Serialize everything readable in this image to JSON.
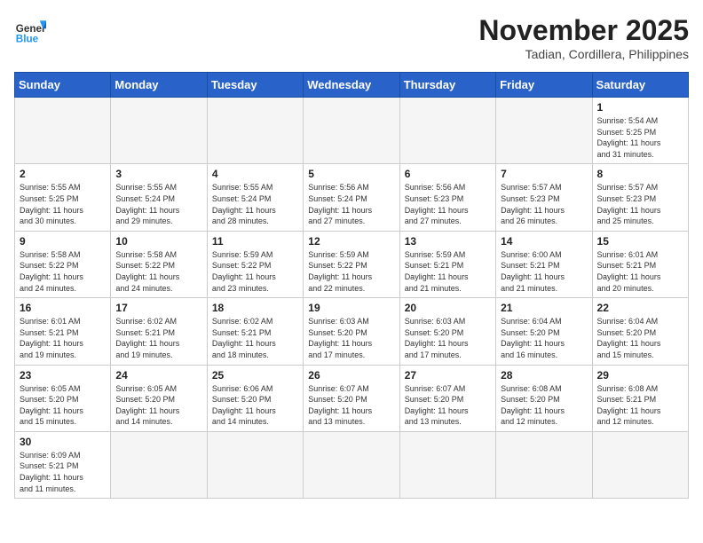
{
  "header": {
    "logo_general": "General",
    "logo_blue": "Blue",
    "month_year": "November 2025",
    "location": "Tadian, Cordillera, Philippines"
  },
  "weekdays": [
    "Sunday",
    "Monday",
    "Tuesday",
    "Wednesday",
    "Thursday",
    "Friday",
    "Saturday"
  ],
  "weeks": [
    [
      {
        "day": "",
        "info": ""
      },
      {
        "day": "",
        "info": ""
      },
      {
        "day": "",
        "info": ""
      },
      {
        "day": "",
        "info": ""
      },
      {
        "day": "",
        "info": ""
      },
      {
        "day": "",
        "info": ""
      },
      {
        "day": "1",
        "info": "Sunrise: 5:54 AM\nSunset: 5:25 PM\nDaylight: 11 hours\nand 31 minutes."
      }
    ],
    [
      {
        "day": "2",
        "info": "Sunrise: 5:55 AM\nSunset: 5:25 PM\nDaylight: 11 hours\nand 30 minutes."
      },
      {
        "day": "3",
        "info": "Sunrise: 5:55 AM\nSunset: 5:24 PM\nDaylight: 11 hours\nand 29 minutes."
      },
      {
        "day": "4",
        "info": "Sunrise: 5:55 AM\nSunset: 5:24 PM\nDaylight: 11 hours\nand 28 minutes."
      },
      {
        "day": "5",
        "info": "Sunrise: 5:56 AM\nSunset: 5:24 PM\nDaylight: 11 hours\nand 27 minutes."
      },
      {
        "day": "6",
        "info": "Sunrise: 5:56 AM\nSunset: 5:23 PM\nDaylight: 11 hours\nand 27 minutes."
      },
      {
        "day": "7",
        "info": "Sunrise: 5:57 AM\nSunset: 5:23 PM\nDaylight: 11 hours\nand 26 minutes."
      },
      {
        "day": "8",
        "info": "Sunrise: 5:57 AM\nSunset: 5:23 PM\nDaylight: 11 hours\nand 25 minutes."
      }
    ],
    [
      {
        "day": "9",
        "info": "Sunrise: 5:58 AM\nSunset: 5:22 PM\nDaylight: 11 hours\nand 24 minutes."
      },
      {
        "day": "10",
        "info": "Sunrise: 5:58 AM\nSunset: 5:22 PM\nDaylight: 11 hours\nand 24 minutes."
      },
      {
        "day": "11",
        "info": "Sunrise: 5:59 AM\nSunset: 5:22 PM\nDaylight: 11 hours\nand 23 minutes."
      },
      {
        "day": "12",
        "info": "Sunrise: 5:59 AM\nSunset: 5:22 PM\nDaylight: 11 hours\nand 22 minutes."
      },
      {
        "day": "13",
        "info": "Sunrise: 5:59 AM\nSunset: 5:21 PM\nDaylight: 11 hours\nand 21 minutes."
      },
      {
        "day": "14",
        "info": "Sunrise: 6:00 AM\nSunset: 5:21 PM\nDaylight: 11 hours\nand 21 minutes."
      },
      {
        "day": "15",
        "info": "Sunrise: 6:01 AM\nSunset: 5:21 PM\nDaylight: 11 hours\nand 20 minutes."
      }
    ],
    [
      {
        "day": "16",
        "info": "Sunrise: 6:01 AM\nSunset: 5:21 PM\nDaylight: 11 hours\nand 19 minutes."
      },
      {
        "day": "17",
        "info": "Sunrise: 6:02 AM\nSunset: 5:21 PM\nDaylight: 11 hours\nand 19 minutes."
      },
      {
        "day": "18",
        "info": "Sunrise: 6:02 AM\nSunset: 5:21 PM\nDaylight: 11 hours\nand 18 minutes."
      },
      {
        "day": "19",
        "info": "Sunrise: 6:03 AM\nSunset: 5:20 PM\nDaylight: 11 hours\nand 17 minutes."
      },
      {
        "day": "20",
        "info": "Sunrise: 6:03 AM\nSunset: 5:20 PM\nDaylight: 11 hours\nand 17 minutes."
      },
      {
        "day": "21",
        "info": "Sunrise: 6:04 AM\nSunset: 5:20 PM\nDaylight: 11 hours\nand 16 minutes."
      },
      {
        "day": "22",
        "info": "Sunrise: 6:04 AM\nSunset: 5:20 PM\nDaylight: 11 hours\nand 15 minutes."
      }
    ],
    [
      {
        "day": "23",
        "info": "Sunrise: 6:05 AM\nSunset: 5:20 PM\nDaylight: 11 hours\nand 15 minutes."
      },
      {
        "day": "24",
        "info": "Sunrise: 6:05 AM\nSunset: 5:20 PM\nDaylight: 11 hours\nand 14 minutes."
      },
      {
        "day": "25",
        "info": "Sunrise: 6:06 AM\nSunset: 5:20 PM\nDaylight: 11 hours\nand 14 minutes."
      },
      {
        "day": "26",
        "info": "Sunrise: 6:07 AM\nSunset: 5:20 PM\nDaylight: 11 hours\nand 13 minutes."
      },
      {
        "day": "27",
        "info": "Sunrise: 6:07 AM\nSunset: 5:20 PM\nDaylight: 11 hours\nand 13 minutes."
      },
      {
        "day": "28",
        "info": "Sunrise: 6:08 AM\nSunset: 5:20 PM\nDaylight: 11 hours\nand 12 minutes."
      },
      {
        "day": "29",
        "info": "Sunrise: 6:08 AM\nSunset: 5:21 PM\nDaylight: 11 hours\nand 12 minutes."
      }
    ],
    [
      {
        "day": "30",
        "info": "Sunrise: 6:09 AM\nSunset: 5:21 PM\nDaylight: 11 hours\nand 11 minutes."
      },
      {
        "day": "",
        "info": ""
      },
      {
        "day": "",
        "info": ""
      },
      {
        "day": "",
        "info": ""
      },
      {
        "day": "",
        "info": ""
      },
      {
        "day": "",
        "info": ""
      },
      {
        "day": "",
        "info": ""
      }
    ]
  ]
}
